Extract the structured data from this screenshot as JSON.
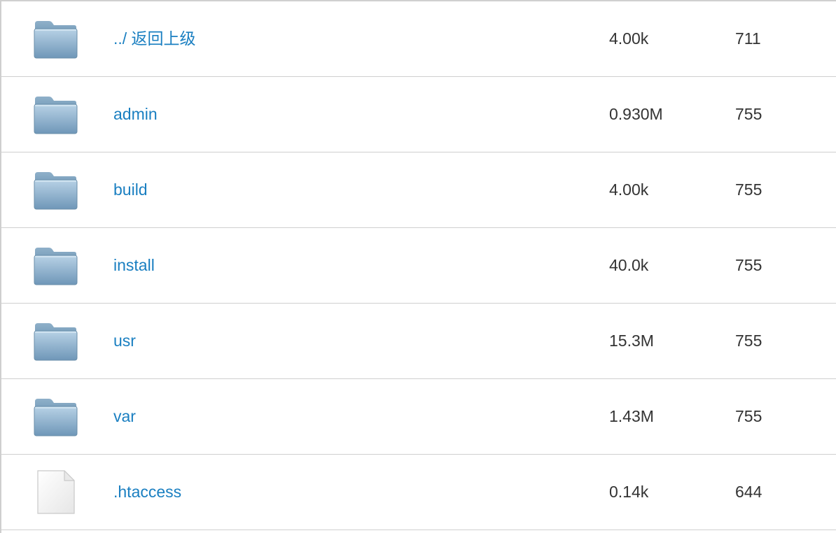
{
  "colors": {
    "link": "#1a7fc1",
    "text": "#333333",
    "border": "#cfcfcf",
    "folder_top": "#a9c6dc",
    "folder_bottom": "#6f97b8"
  },
  "rows": [
    {
      "type": "folder",
      "icon": "folder-icon",
      "name": "../ 返回上级",
      "size": "4.00k",
      "perms": "711"
    },
    {
      "type": "folder",
      "icon": "folder-icon",
      "name": "admin",
      "size": "0.930M",
      "perms": "755"
    },
    {
      "type": "folder",
      "icon": "folder-icon",
      "name": "build",
      "size": "4.00k",
      "perms": "755"
    },
    {
      "type": "folder",
      "icon": "folder-icon",
      "name": "install",
      "size": "40.0k",
      "perms": "755"
    },
    {
      "type": "folder",
      "icon": "folder-icon",
      "name": "usr",
      "size": "15.3M",
      "perms": "755"
    },
    {
      "type": "folder",
      "icon": "folder-icon",
      "name": "var",
      "size": "1.43M",
      "perms": "755"
    },
    {
      "type": "file",
      "icon": "file-icon",
      "name": ".htaccess",
      "size": "0.14k",
      "perms": "644"
    }
  ]
}
